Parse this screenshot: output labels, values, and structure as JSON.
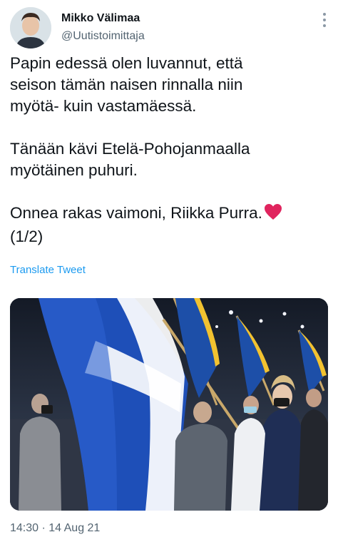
{
  "author": {
    "name": "Mikko Välimaa",
    "handle": "@Uutistoimittaja"
  },
  "tweet": {
    "paragraphs": [
      [
        "Papin edessä olen luvannut, että",
        "seison tämän naisen rinnalla niin",
        "myötä- kuin vastamäessä."
      ],
      [
        "Tänään kävi Etelä-Pohojanmaalla",
        "myötäinen puhuri."
      ],
      [
        "Onnea rakas vaimoni, Riikka Purra.",
        "(1/2)"
      ]
    ],
    "translate_label": "Translate Tweet",
    "timestamp": "14:30 · 14 Aug 21"
  },
  "icons": {
    "more": "more-vertical-icon",
    "heart": "red-heart-emoji"
  },
  "colors": {
    "text": "#0f1419",
    "secondary": "#536471",
    "link": "#1d9bf0",
    "heart": "#e0245e"
  }
}
